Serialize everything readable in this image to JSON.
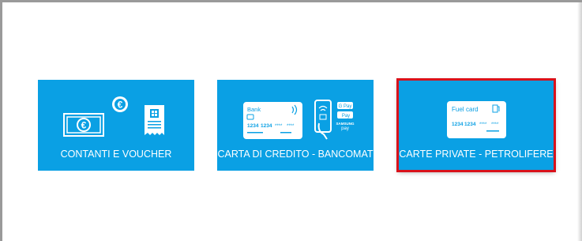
{
  "payment_options": [
    {
      "label": "CONTANTI E VOUCHER",
      "icon": "cash-voucher-icon",
      "selected": false
    },
    {
      "label": "CARTA DI CREDITO - BANCOMAT",
      "icon": "credit-card-phone-icon",
      "selected": false,
      "card_text": {
        "bank": "Bank",
        "number_a": "1234",
        "number_b": "1234",
        "number_c": "****",
        "number_d": "****"
      },
      "wallets": [
        "G Pay",
        "Pay",
        "SAMSUNG",
        "pay"
      ]
    },
    {
      "label": "CARTE PRIVATE - PETROLIFERE",
      "icon": "fuel-card-icon",
      "selected": true,
      "card_text": {
        "title_a": "Fuel",
        "title_b": "card",
        "number_a": "1234",
        "number_b": "1234",
        "number_c": "****",
        "number_d": "****"
      }
    }
  ],
  "colors": {
    "tile": "#0aa0e4",
    "selection": "#d9121b"
  }
}
